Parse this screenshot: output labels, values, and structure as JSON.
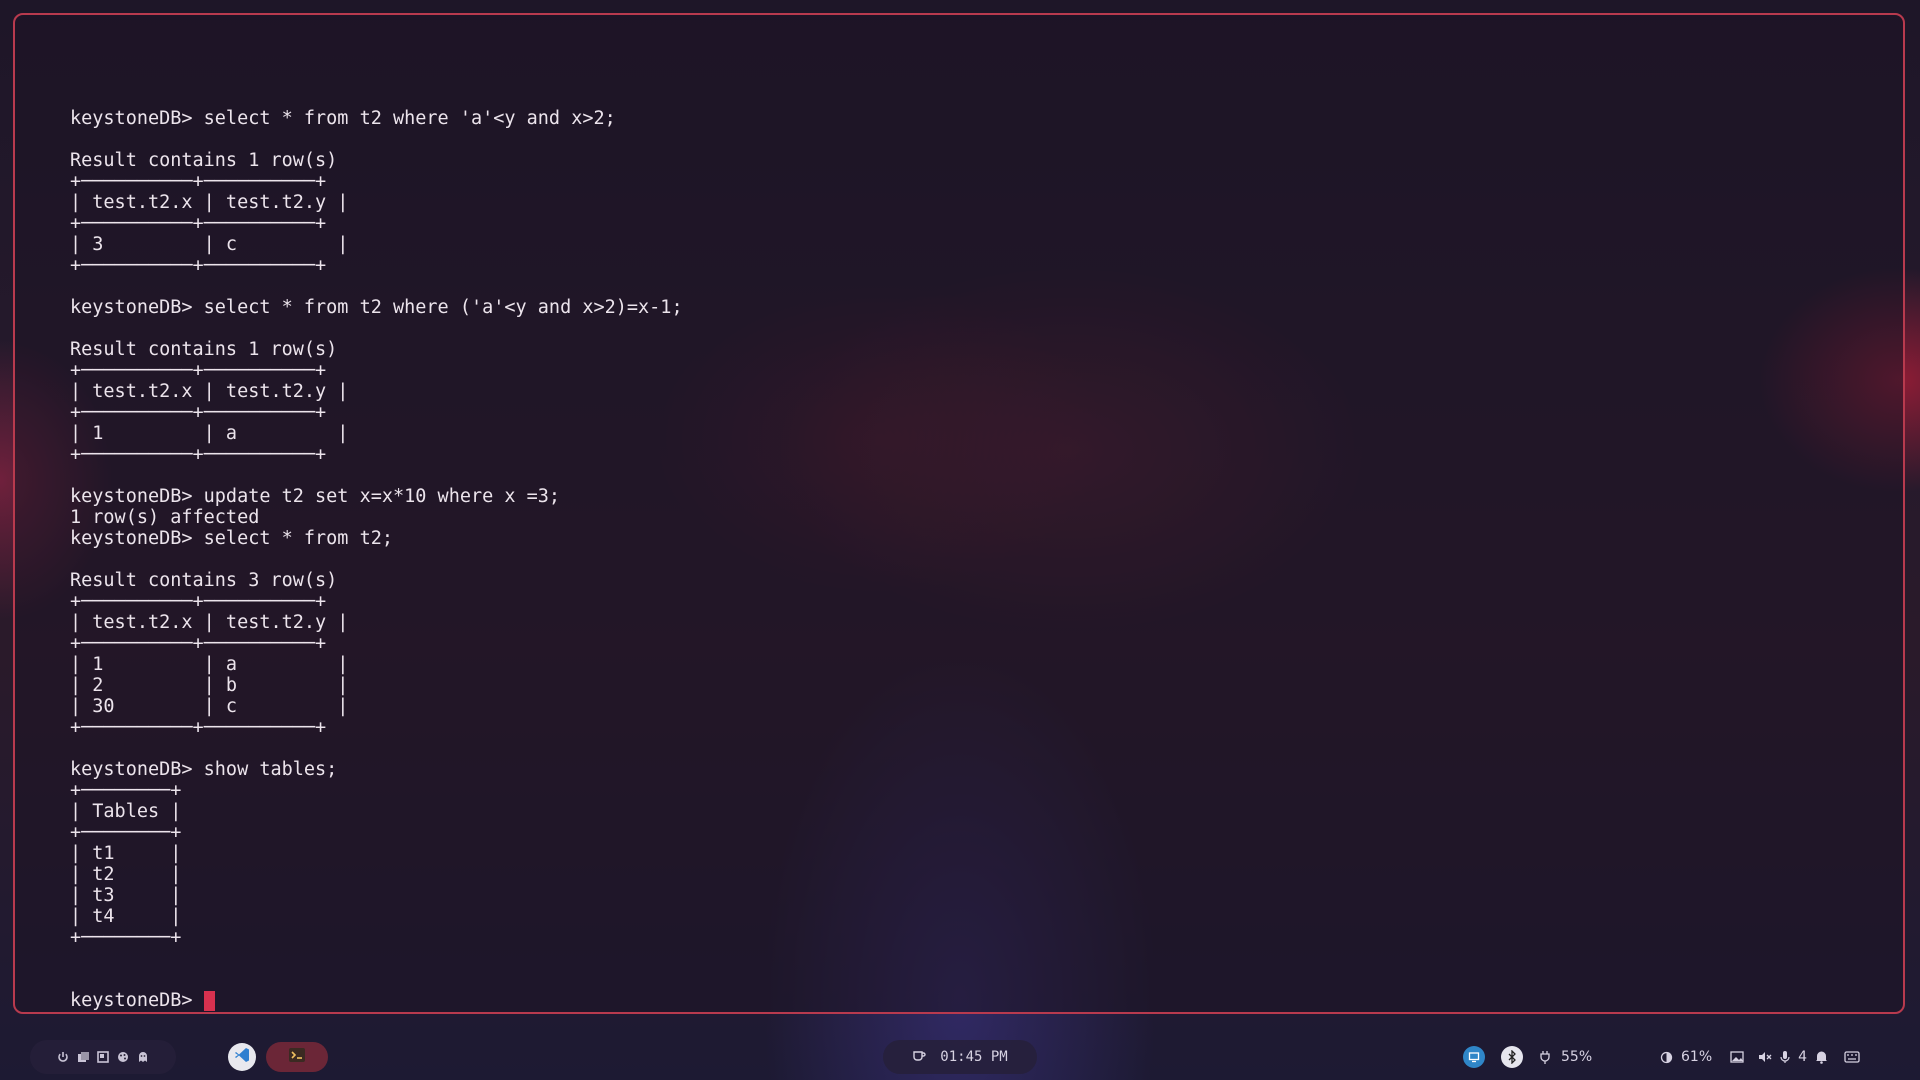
{
  "terminal": {
    "lines": [
      "",
      "keystoneDB> select * from t2 where 'a'<y and x>2;",
      "",
      "Result contains 1 row(s)",
      "+──────────+──────────+",
      "| test.t2.x | test.t2.y |",
      "+──────────+──────────+",
      "| 3         | c         |",
      "+──────────+──────────+",
      "",
      "keystoneDB> select * from t2 where ('a'<y and x>2)=x-1;",
      "",
      "Result contains 1 row(s)",
      "+──────────+──────────+",
      "| test.t2.x | test.t2.y |",
      "+──────────+──────────+",
      "| 1         | a         |",
      "+──────────+──────────+",
      "",
      "keystoneDB> update t2 set x=x*10 where x =3;",
      "1 row(s) affected",
      "keystoneDB> select * from t2;",
      "",
      "Result contains 3 row(s)",
      "+──────────+──────────+",
      "| test.t2.x | test.t2.y |",
      "+──────────+──────────+",
      "| 1         | a         |",
      "| 2         | b         |",
      "| 30        | c         |",
      "+──────────+──────────+",
      "",
      "keystoneDB> show tables;",
      "+────────+",
      "| Tables |",
      "+────────+",
      "| t1     |",
      "| t2     |",
      "| t3     |",
      "| t4     |",
      "+────────+",
      "",
      ""
    ],
    "prompt": "keystoneDB>",
    "cursor_color": "#d8314f",
    "border_color": "#b83a4e"
  },
  "taskbar": {
    "left_icons": [
      "power-icon",
      "files-icon",
      "window-icon",
      "palette-icon",
      "ghost-icon"
    ],
    "apps": [
      {
        "name": "vscode-icon"
      },
      {
        "name": "terminal-icon",
        "active": true
      }
    ],
    "clock": "01:45 PM",
    "right": {
      "battery": "55%",
      "brightness": "61%",
      "notifications": "4"
    }
  }
}
